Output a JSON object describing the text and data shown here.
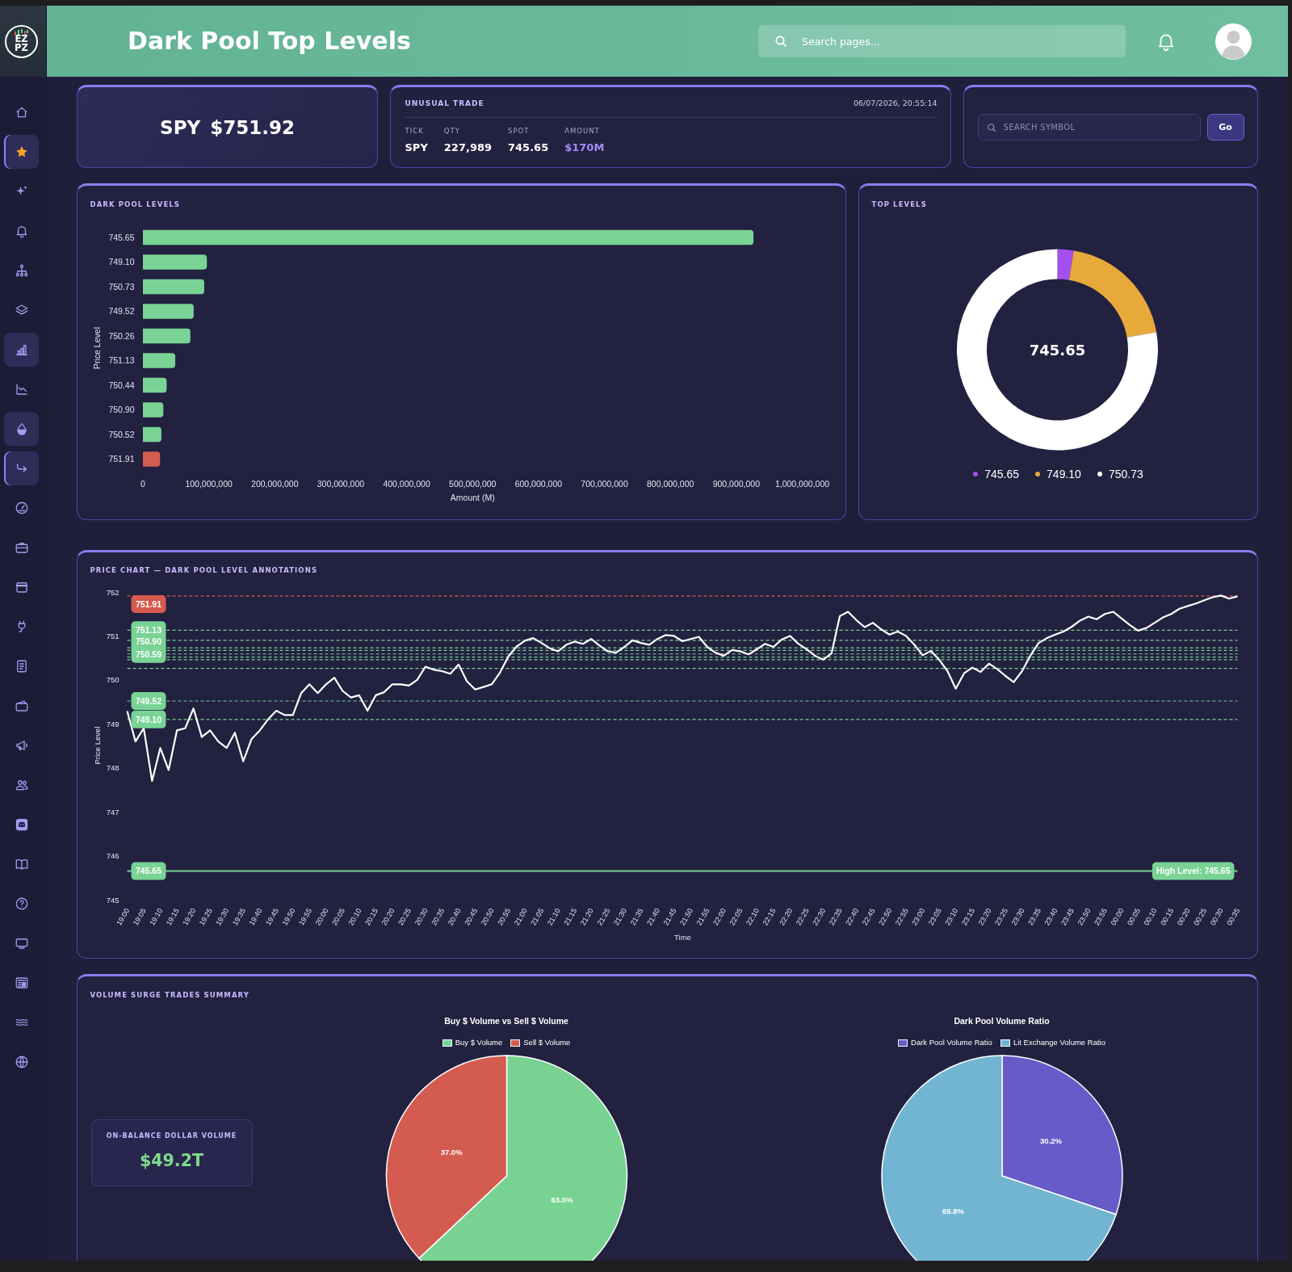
{
  "sidebar": {
    "logo": [
      "EZ",
      "PZ"
    ],
    "items": [
      {
        "kind": "home",
        "selected": false,
        "highlighted": false
      },
      {
        "kind": "star",
        "selected": true,
        "highlighted": true
      },
      {
        "kind": "sparkles",
        "selected": false,
        "highlighted": false
      },
      {
        "kind": "bell",
        "selected": false,
        "highlighted": false
      },
      {
        "kind": "hierarchy",
        "selected": false,
        "highlighted": false
      },
      {
        "kind": "layers",
        "selected": false,
        "highlighted": false
      },
      {
        "kind": "bar-chart",
        "selected": false,
        "highlighted": true
      },
      {
        "kind": "trend-down",
        "selected": false,
        "highlighted": false
      },
      {
        "kind": "drop",
        "selected": false,
        "highlighted": true
      },
      {
        "kind": "arrow-turn",
        "selected": true,
        "highlighted": true
      },
      {
        "kind": "gauge",
        "selected": false,
        "highlighted": false
      },
      {
        "kind": "briefcase",
        "selected": false,
        "highlighted": false
      },
      {
        "kind": "calendar",
        "selected": false,
        "highlighted": false
      },
      {
        "kind": "plug",
        "selected": false,
        "highlighted": false
      },
      {
        "kind": "notebook",
        "selected": false,
        "highlighted": false
      },
      {
        "kind": "wallet",
        "selected": false,
        "highlighted": false
      },
      {
        "kind": "megaphone",
        "selected": false,
        "highlighted": false
      },
      {
        "kind": "users",
        "selected": false,
        "highlighted": false
      },
      {
        "kind": "chat",
        "selected": false,
        "highlighted": false
      },
      {
        "kind": "book",
        "selected": false,
        "highlighted": false
      },
      {
        "kind": "question",
        "selected": false,
        "highlighted": false
      },
      {
        "kind": "monitor",
        "selected": false,
        "highlighted": false
      },
      {
        "kind": "newspaper",
        "selected": false,
        "highlighted": false
      },
      {
        "kind": "waves",
        "selected": false,
        "highlighted": false
      },
      {
        "kind": "globe",
        "selected": false,
        "highlighted": false
      }
    ]
  },
  "header": {
    "title": "Dark Pool Top Levels",
    "search": {
      "placeholder": "Search pages..."
    }
  },
  "quote": {
    "ticker": "SPY",
    "price": "$751.92"
  },
  "unusual_trade": {
    "title": "UNUSUAL TRADE",
    "timestamp": "06/07/2026, 20:55:14",
    "fields": [
      {
        "label": "TICK",
        "value": "SPY",
        "kind": "plain"
      },
      {
        "label": "QTY",
        "value": "227,989",
        "kind": "plain"
      },
      {
        "label": "SPOT",
        "value": "745.65",
        "kind": "plain"
      },
      {
        "label": "AMOUNT",
        "value": "$170M",
        "kind": "amount"
      }
    ]
  },
  "symbol_search": {
    "placeholder": "SEARCH SYMBOL",
    "button": "Go"
  },
  "dark_pool_levels": {
    "title": "DARK POOL LEVELS",
    "chart_data": {
      "type": "bar",
      "orientation": "horizontal",
      "stacked": true,
      "xlabel": "Amount (M)",
      "ylabel": "Price Level",
      "categories": [
        "745.65",
        "749.10",
        "750.73",
        "749.52",
        "750.26",
        "751.13",
        "750.44",
        "750.90",
        "750.52",
        "751.91"
      ],
      "series": [
        {
          "color": "#79d395",
          "values": [
            926000000,
            97000000,
            93000000,
            77000000,
            72000000,
            49000000,
            36000000,
            31000000,
            28000000,
            null
          ]
        },
        {
          "color": "#d55c51",
          "values": [
            null,
            null,
            null,
            null,
            null,
            null,
            null,
            null,
            null,
            26000000
          ]
        }
      ],
      "xlim": [
        0,
        1000000000
      ],
      "xticks": [
        {
          "value": 0,
          "label": "0"
        },
        {
          "value": 100000000,
          "label": "100,000,000"
        },
        {
          "value": 200000000,
          "label": "200,000,000"
        },
        {
          "value": 300000000,
          "label": "300,000,000"
        },
        {
          "value": 400000000,
          "label": "400,000,000"
        },
        {
          "value": 500000000,
          "label": "500,000,000"
        },
        {
          "value": 600000000,
          "label": "600,000,000"
        },
        {
          "value": 700000000,
          "label": "700,000,000"
        },
        {
          "value": 800000000,
          "label": "800,000,000"
        },
        {
          "value": 900000000,
          "label": "900,000,000"
        },
        {
          "value": 1000000000,
          "label": "1,000,000,000"
        }
      ]
    }
  },
  "top_levels": {
    "title": "TOP LEVELS",
    "center_label": "745.65",
    "legend": [
      {
        "label": "745.65",
        "color": "#a64ff0"
      },
      {
        "label": "749.10",
        "color": "#e6a93a"
      },
      {
        "label": "750.73",
        "color": "#ffffff"
      }
    ]
  },
  "price_chart": {
    "title": "PRICE CHART — DARK POOL LEVEL ANNOTATIONS",
    "chart_data": {
      "type": "line",
      "xlabel": "Time",
      "ylabel": "Price Level",
      "ylim": [
        745,
        752
      ],
      "yticks": [
        745,
        746,
        747,
        748,
        749,
        750,
        751,
        752
      ],
      "categories": [
        "19:00",
        null,
        "19:05",
        null,
        "19:10",
        null,
        "19:15",
        null,
        "19:20",
        null,
        "19:25",
        null,
        "19:30",
        null,
        "19:35",
        null,
        "19:40",
        null,
        "19:45",
        null,
        "19:50",
        null,
        "19:55",
        null,
        "20:00",
        null,
        "20:05",
        null,
        "20:10",
        null,
        "20:15",
        null,
        "20:20",
        null,
        "20:25",
        null,
        "20:30",
        null,
        "20:35",
        null,
        "20:40",
        null,
        "20:45",
        null,
        "20:50",
        null,
        "20:55",
        null,
        "21:00",
        null,
        "21:05",
        null,
        "21:10",
        null,
        "21:15",
        null,
        "21:20",
        null,
        "21:25",
        null,
        "21:30",
        null,
        "21:35",
        null,
        "21:40",
        null,
        "21:45",
        null,
        "21:50",
        null,
        "21:55",
        null,
        "22:00",
        null,
        "22:05",
        null,
        "22:10",
        null,
        "22:15",
        null,
        "22:20",
        null,
        "22:25",
        null,
        "22:30",
        null,
        "22:35",
        null,
        "22:40",
        null,
        "22:45",
        null,
        "22:50",
        null,
        "22:55",
        null,
        "23:00",
        null,
        "23:05",
        null,
        "23:10",
        null,
        "23:15",
        null,
        "23:20",
        null,
        "23:25",
        null,
        "23:30",
        null,
        "23:35",
        null,
        "23:40",
        null,
        "23:45",
        null,
        "23:50",
        null,
        "23:55",
        null,
        "00:00",
        null,
        "00:05",
        null,
        "00:10",
        null,
        "00:15",
        null,
        "00:20",
        null,
        "00:25",
        null,
        "00:30",
        null,
        "00:35"
      ],
      "series": [
        {
          "color": "#ffffff",
          "values": [
            749.29,
            748.6,
            748.9,
            747.7,
            748.45,
            747.95,
            748.85,
            748.9,
            749.35,
            748.7,
            748.85,
            748.6,
            748.45,
            748.8,
            748.15,
            748.65,
            748.85,
            749.1,
            749.3,
            749.2,
            749.2,
            749.7,
            749.9,
            749.7,
            749.9,
            750.05,
            749.75,
            749.6,
            749.65,
            749.3,
            749.65,
            749.72,
            749.9,
            749.9,
            749.87,
            750.0,
            750.3,
            750.23,
            750.2,
            750.14,
            750.35,
            749.97,
            749.78,
            749.84,
            749.9,
            750.17,
            750.53,
            750.76,
            750.89,
            750.95,
            750.84,
            750.72,
            750.65,
            750.8,
            750.87,
            750.82,
            750.93,
            750.78,
            750.65,
            750.62,
            750.75,
            750.9,
            750.84,
            750.8,
            750.93,
            751.02,
            751.0,
            750.88,
            750.93,
            750.98,
            750.75,
            750.62,
            750.55,
            750.68,
            750.65,
            750.58,
            750.7,
            750.82,
            750.75,
            750.92,
            751.0,
            750.82,
            750.7,
            750.55,
            750.46,
            750.6,
            751.45,
            751.55,
            751.36,
            751.2,
            751.3,
            751.15,
            751.03,
            751.1,
            751.0,
            750.8,
            750.56,
            750.66,
            750.46,
            750.2,
            749.8,
            750.15,
            750.28,
            750.18,
            750.37,
            750.25,
            750.09,
            749.95,
            750.2,
            750.55,
            750.84,
            750.95,
            751.03,
            751.1,
            751.21,
            751.35,
            751.44,
            751.38,
            751.5,
            751.55,
            751.4,
            751.25,
            751.12,
            751.18,
            751.3,
            751.42,
            751.5,
            751.62,
            751.68,
            751.74,
            751.81,
            751.88,
            751.92,
            751.85,
            751.9
          ]
        }
      ],
      "ref_lines": [
        {
          "axis": "y",
          "value": 751.91,
          "label": "751.91",
          "color": "#d65a4e"
        },
        {
          "axis": "y",
          "value": 751.13,
          "label": "751.13",
          "color": "#79d395"
        },
        {
          "axis": "y",
          "value": 750.9,
          "label": "750.90",
          "color": "#79d395"
        },
        {
          "axis": "y",
          "value": 750.73,
          "color": "#79d395"
        },
        {
          "axis": "y",
          "value": 750.67,
          "color": "#79d395"
        },
        {
          "axis": "y",
          "value": 750.59,
          "label": "750.59",
          "color": "#79d395"
        },
        {
          "axis": "y",
          "value": 750.52,
          "color": "#79d395"
        },
        {
          "axis": "y",
          "value": 750.46,
          "color": "#79d395"
        },
        {
          "axis": "y",
          "value": 750.26,
          "color": "#79d395"
        },
        {
          "axis": "y",
          "value": 749.52,
          "label": "749.52",
          "color": "#79d395"
        },
        {
          "axis": "y",
          "value": 749.1,
          "label": "749.10",
          "color": "#79d395"
        },
        {
          "axis": "y",
          "value": 745.65,
          "label": "745.65",
          "color": "#79d395"
        }
      ],
      "annotations": [
        "High Level: 745.65"
      ]
    }
  },
  "volume_surge": {
    "title": "VOLUME SURGE TRADES SUMMARY",
    "on_balance": {
      "label": "ON-BALANCE DOLLAR VOLUME",
      "value": "$49.2T"
    },
    "charts": [
      {
        "legend": [
          {
            "color": "#78d393"
          },
          {
            "color": "#d45b50"
          }
        ],
        "chart_data": {
          "type": "pie",
          "title": "Buy $ Volume vs Sell $ Volume",
          "categories": [
            "Buy $ Volume",
            "Sell $ Volume"
          ],
          "values": [
            63.0,
            37.0
          ],
          "value_labels": [
            "63.0%",
            "37.0%"
          ]
        }
      },
      {
        "legend": [
          {
            "color": "#675bc9"
          },
          {
            "color": "#72b5d3"
          }
        ],
        "chart_data": {
          "type": "pie",
          "title": "Dark Pool Volume Ratio",
          "categories": [
            "Dark Pool Volume Ratio",
            "Lit Exchange Volume Ratio"
          ],
          "values": [
            30.2,
            69.8
          ],
          "value_labels": [
            "30.2%",
            "69.8%"
          ]
        }
      }
    ]
  }
}
